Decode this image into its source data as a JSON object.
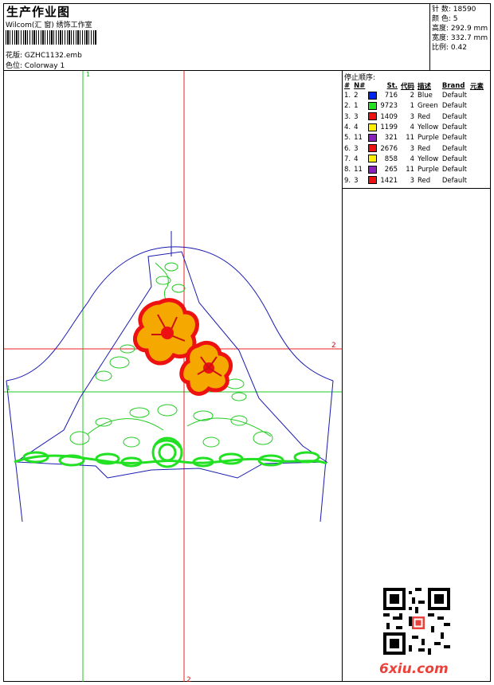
{
  "header": {
    "title": "生产作业图",
    "company": "Wilcom(汇 窗) 绣饰工作室",
    "design_label": "花版:",
    "design_value": "GZHC1132.emb",
    "colorway_label": "色位:",
    "colorway_value": "Colorway 1"
  },
  "stats": [
    {
      "label": "针 数:",
      "value": "18590"
    },
    {
      "label": "颜 色:",
      "value": "5"
    },
    {
      "label": "高度:",
      "value": "292.9 mm"
    },
    {
      "label": "宽度:",
      "value": "332.7 mm"
    },
    {
      "label": "比例:",
      "value": "0.42"
    }
  ],
  "stop_sequence": {
    "title": "停止顺序:",
    "headers": [
      "#",
      "N#",
      "St.",
      "代码",
      "描述",
      "Brand",
      "元素"
    ],
    "rows": [
      {
        "n": "1.",
        "nn": "2",
        "color": "#0022ee",
        "st": "716",
        "code": "2",
        "desc": "Blue",
        "brand": "Default"
      },
      {
        "n": "2.",
        "nn": "1",
        "color": "#22e022",
        "st": "9723",
        "code": "1",
        "desc": "Green",
        "brand": "Default"
      },
      {
        "n": "3.",
        "nn": "3",
        "color": "#ee1111",
        "st": "1409",
        "code": "3",
        "desc": "Red",
        "brand": "Default"
      },
      {
        "n": "4.",
        "nn": "4",
        "color": "#ffee00",
        "st": "1199",
        "code": "4",
        "desc": "Yellow",
        "brand": "Default"
      },
      {
        "n": "5.",
        "nn": "11",
        "color": "#8822bb",
        "st": "321",
        "code": "11",
        "desc": "Purple",
        "brand": "Default"
      },
      {
        "n": "6.",
        "nn": "3",
        "color": "#ee1111",
        "st": "2676",
        "code": "3",
        "desc": "Red",
        "brand": "Default"
      },
      {
        "n": "7.",
        "nn": "4",
        "color": "#ffee00",
        "st": "858",
        "code": "4",
        "desc": "Yellow",
        "brand": "Default"
      },
      {
        "n": "8.",
        "nn": "11",
        "color": "#8822bb",
        "st": "265",
        "code": "11",
        "desc": "Purple",
        "brand": "Default"
      },
      {
        "n": "9.",
        "nn": "3",
        "color": "#ee1111",
        "st": "1421",
        "code": "3",
        "desc": "Red",
        "brand": "Default"
      }
    ]
  },
  "guides": {
    "v1": "1",
    "h2_right": "2",
    "v2_bottom": "2",
    "h1_left": "1"
  },
  "watermark": "6xiu.com"
}
